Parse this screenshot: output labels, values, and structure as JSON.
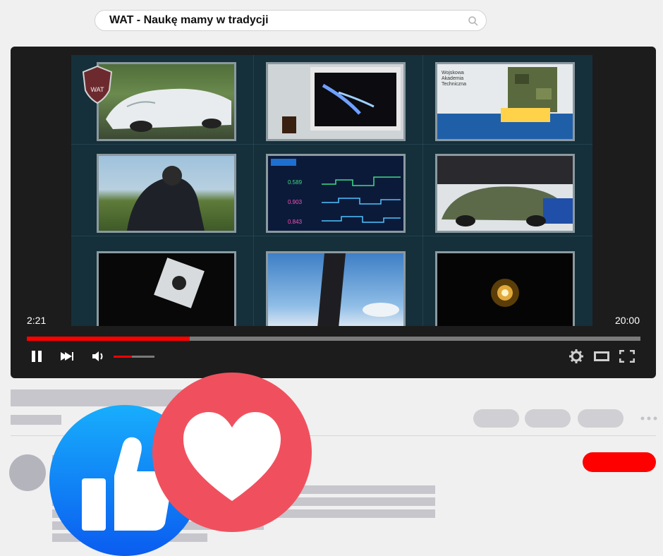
{
  "search": {
    "query": "WAT - Naukę mamy w tradycji"
  },
  "player": {
    "current_time": "2:21",
    "duration": "20:00",
    "progress_fraction": 0.265,
    "volume_fraction": 0.45,
    "colors": {
      "progress": "#ff0000",
      "background": "#1c1c1c"
    }
  },
  "icons": {
    "search": "search-icon",
    "pause": "pause-icon",
    "next": "next-icon",
    "volume": "volume-icon",
    "settings": "gear-icon",
    "theater": "theater-icon",
    "fullscreen": "fullscreen-icon",
    "more": "more-icon"
  },
  "reactions": {
    "like_color": "#1877f2",
    "love_color": "#f0505e"
  },
  "video_frame": {
    "tile_labels": [
      "Wojskowa",
      "Akademia",
      "Techniczna"
    ],
    "dashboard_values": [
      "0.589",
      "0.903",
      "0.843"
    ],
    "logo_text": "WAT"
  }
}
